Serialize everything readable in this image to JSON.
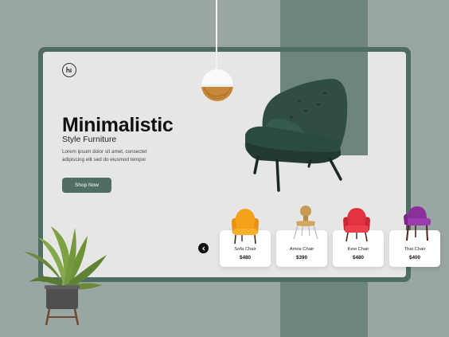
{
  "hero": {
    "title": "Minimalistic",
    "subtitle": "Style Furniture",
    "description": "Lorem ipsum dolor sit amet, consectet adipiscing elit sed do eiusmod tempor",
    "shop_button": "Shop Now"
  },
  "products": [
    {
      "name": "Sofa Chair",
      "price": "$480",
      "color": "#f3a21a"
    },
    {
      "name": "Amos Chair",
      "price": "$390",
      "color": "#c89a55"
    },
    {
      "name": "Kew Chair",
      "price": "$480",
      "color": "#e0323f"
    },
    {
      "name": "That Chair",
      "price": "$400",
      "color": "#8a2f9c"
    }
  ],
  "icons": {
    "logo": "brand-logo-icon",
    "prev": "chevron-left-icon"
  },
  "colors": {
    "accent": "#4f6d63",
    "band": "#6e857d",
    "background": "#9aa6a3",
    "screen": "#e6e6e4"
  }
}
